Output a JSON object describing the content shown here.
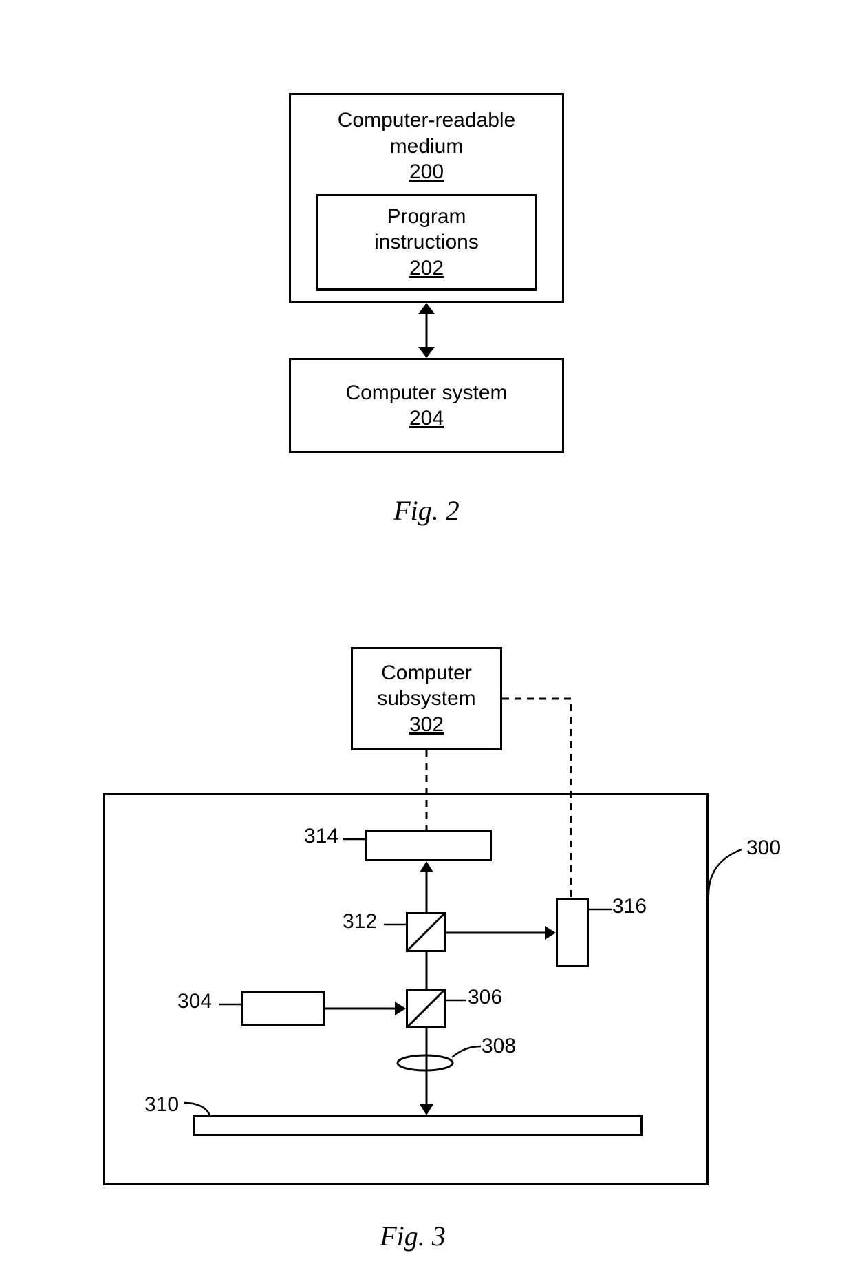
{
  "fig2": {
    "caption": "Fig. 2",
    "medium": {
      "label": "Computer-readable\nmedium",
      "ref": "200"
    },
    "instructions": {
      "label": "Program\ninstructions",
      "ref": "202"
    },
    "system": {
      "label": "Computer system",
      "ref": "204"
    }
  },
  "fig3": {
    "caption": "Fig. 3",
    "subsystem": {
      "label": "Computer\nsubsystem",
      "ref": "302"
    },
    "container_ref": "300",
    "ref_304": "304",
    "ref_306": "306",
    "ref_308": "308",
    "ref_310": "310",
    "ref_312": "312",
    "ref_314": "314",
    "ref_316": "316"
  }
}
